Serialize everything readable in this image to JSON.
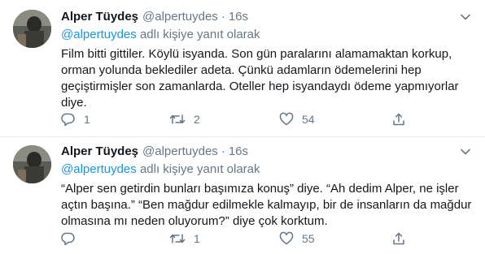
{
  "tweets": [
    {
      "name": "Alper Tüydeş",
      "handle": "@alpertuydes",
      "dot": "·",
      "time": "16s",
      "reply_mention": "@alpertuydes",
      "reply_suffix": " adlı kişiye yanıt olarak",
      "text": "Film bitti gittiler. Köylü isyanda. Son gün paralarını alamamaktan korkup, orman yolunda beklediler adeta. Çünkü adamların ödemelerini hep geçiştirmişler son zamanlarda. Oteller hep isyandaydı ödeme yapmıyorlar diye.",
      "replies": "1",
      "retweets": "2",
      "likes": "54"
    },
    {
      "name": "Alper Tüydeş",
      "handle": "@alpertuydes",
      "dot": "·",
      "time": "16s",
      "reply_mention": "@alpertuydes",
      "reply_suffix": " adlı kişiye yanıt olarak",
      "text": "“Alper sen getirdin bunları başımıza konuş” diye. “Ah dedim Alper, ne işler açtın başına.” “Ben mağdur edilmekle kalmayıp, bir de insanların da mağdur olmasına mı neden oluyorum?” diye çok korktum.",
      "replies": "",
      "retweets": "1",
      "likes": "55"
    }
  ],
  "icons": {
    "caret": "chevron-down-icon",
    "reply": "reply-icon",
    "retweet": "retweet-icon",
    "like": "heart-icon",
    "share": "share-icon"
  },
  "colors": {
    "text": "#14171a",
    "secondary": "#657786",
    "link": "#1b95e0",
    "divider": "#e6ecf0"
  }
}
